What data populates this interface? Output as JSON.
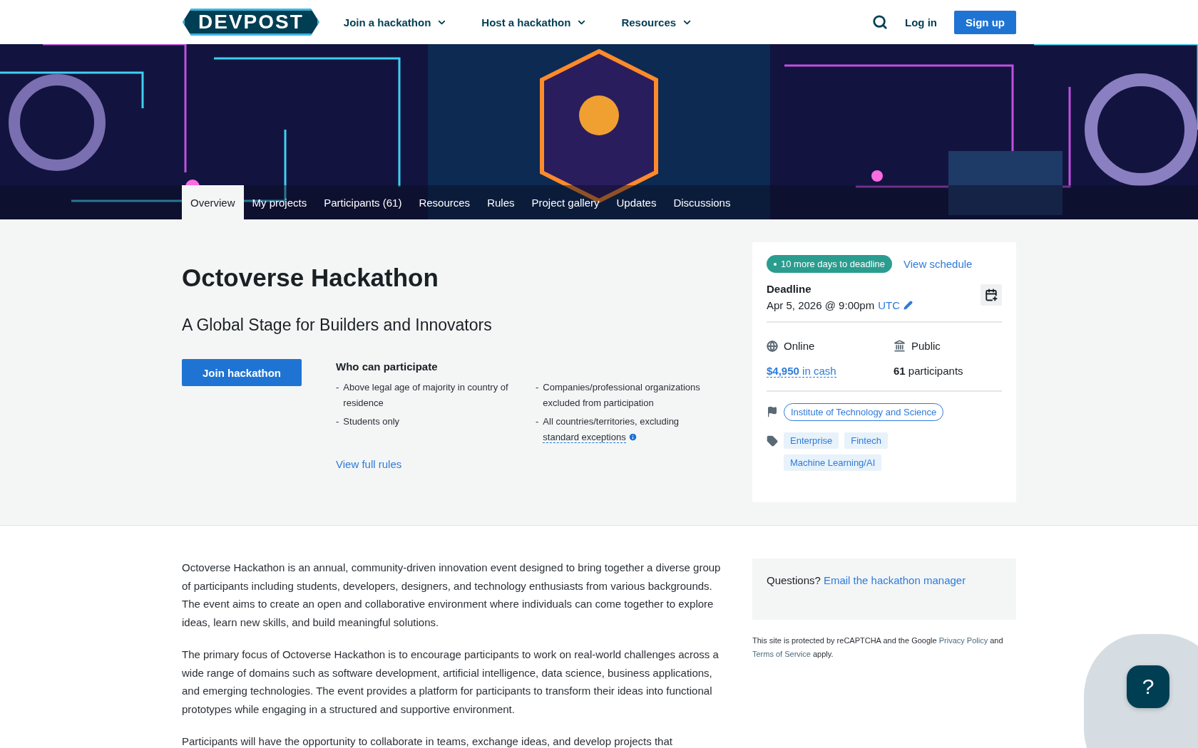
{
  "header": {
    "logo": "DEVPOST",
    "nav": [
      {
        "label": "Join a hackathon"
      },
      {
        "label": "Host a hackathon"
      },
      {
        "label": "Resources"
      }
    ],
    "login": "Log in",
    "signup": "Sign up"
  },
  "tabs": [
    {
      "label": "Overview",
      "selected": true
    },
    {
      "label": "My projects",
      "selected": false
    },
    {
      "label": "Participants (61)",
      "selected": false
    },
    {
      "label": "Resources",
      "selected": false
    },
    {
      "label": "Rules",
      "selected": false
    },
    {
      "label": "Project gallery",
      "selected": false
    },
    {
      "label": "Updates",
      "selected": false
    },
    {
      "label": "Discussions",
      "selected": false
    }
  ],
  "hero": {
    "title": "Octoverse Hackathon",
    "tagline": "A Global Stage for Builders and Innovators",
    "join_button": "Join hackathon",
    "eligibility": {
      "heading": "Who can participate",
      "columns": [
        [
          {
            "bullet": "-",
            "text": "Above legal age of majority in country of residence"
          },
          {
            "bullet": "-",
            "text": "Students only"
          }
        ],
        [
          {
            "bullet": "-",
            "text": "Companies/professional organizations excluded from participation"
          },
          {
            "bullet": "-",
            "text": "All countries/territories, excluding",
            "link": "standard exceptions"
          }
        ]
      ],
      "rules_link": "View full rules"
    }
  },
  "card": {
    "status": "10 more days to deadline",
    "schedule_link": "View schedule",
    "deadline_label": "Deadline",
    "deadline": "Apr 5, 2026 @ 9:00pm",
    "timezone": "UTC",
    "location": "Online",
    "visibility": "Public",
    "prize": "**$4,950** in cash",
    "participants": "**61** participants",
    "host": "Institute of Technology and Science",
    "themes": [
      "Enterprise",
      "Fintech",
      "Machine Learning/AI"
    ]
  },
  "body": {
    "paragraphs": [
      "Octoverse Hackathon is an annual, community-driven innovation event designed to bring together a diverse group of participants including students, developers, designers, and technology enthusiasts from various backgrounds. The event aims to create an open and collaborative environment where individuals can come together to explore ideas, learn new skills, and build meaningful solutions.",
      "The primary focus of Octoverse Hackathon is to encourage participants to work on real-world challenges across a wide range of domains such as software development, artificial intelligence, data science, business applications, and emerging technologies. The event provides a platform for participants to transform their ideas into functional prototypes while engaging in a structured and supportive environment.",
      "Participants will have the opportunity to collaborate in teams, exchange ideas, and develop projects that"
    ]
  },
  "sidebar": {
    "questions": "Questions?",
    "email_link": "Email the hackathon manager",
    "recaptcha": [
      {
        "text": "This site is protected by reCAPTCHA and the Google "
      },
      {
        "text": "Privacy Policy",
        "link": true
      },
      {
        "text": " and "
      },
      {
        "text": "Terms of Service",
        "link": true
      },
      {
        "text": " apply."
      }
    ]
  },
  "help_button": "?"
}
